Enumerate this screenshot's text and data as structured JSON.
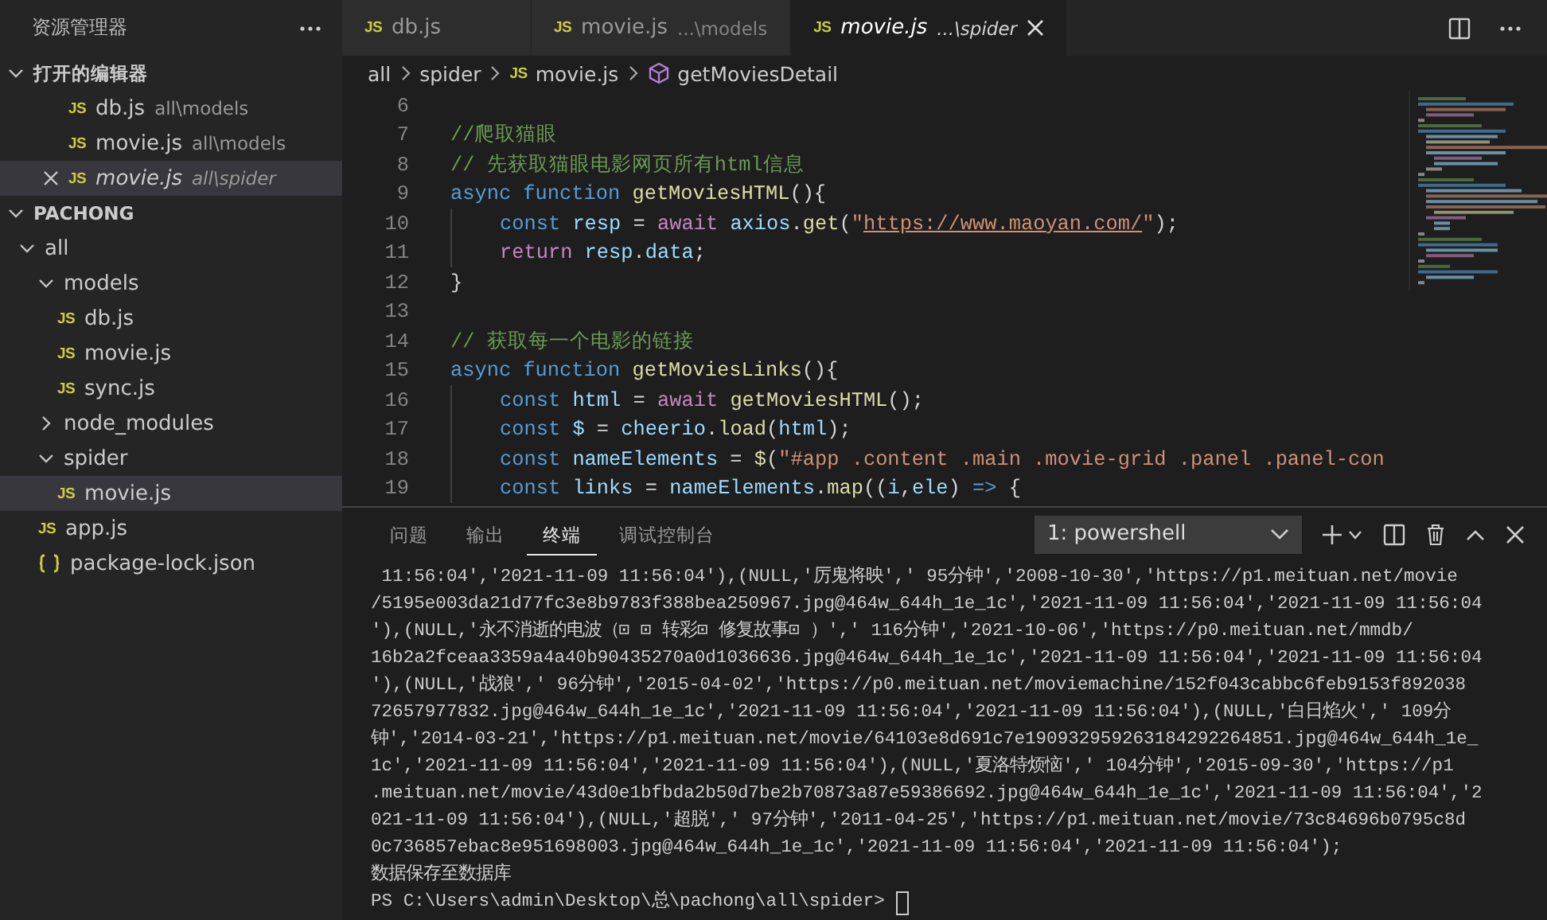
{
  "sidebar": {
    "title": "资源管理器",
    "open_editors": {
      "label": "打开的编辑器",
      "expanded": true,
      "items": [
        {
          "icon": "JS",
          "name": "db.js",
          "path": "all\\models",
          "selected": false,
          "preview": false
        },
        {
          "icon": "JS",
          "name": "movie.js",
          "path": "all\\models",
          "selected": false,
          "preview": false
        },
        {
          "icon": "JS",
          "name": "movie.js",
          "path": "all\\spider",
          "selected": true,
          "preview": true
        }
      ]
    },
    "project": {
      "label": "PACHONG",
      "expanded": true,
      "items": [
        {
          "label": "all",
          "kind": "folder",
          "expanded": true,
          "selected": false,
          "children": [
            {
              "label": "models",
              "kind": "folder",
              "expanded": true,
              "selected": false,
              "children": [
                {
                  "label": "db.js",
                  "kind": "js",
                  "icon": "JS",
                  "selected": false
                },
                {
                  "label": "movie.js",
                  "kind": "js",
                  "icon": "JS",
                  "selected": false
                },
                {
                  "label": "sync.js",
                  "kind": "js",
                  "icon": "JS",
                  "selected": false
                }
              ]
            },
            {
              "label": "node_modules",
              "kind": "folder",
              "expanded": false,
              "selected": false
            },
            {
              "label": "spider",
              "kind": "folder",
              "expanded": true,
              "selected": false,
              "children": [
                {
                  "label": "movie.js",
                  "kind": "js",
                  "icon": "JS",
                  "selected": true
                }
              ]
            },
            {
              "label": "app.js",
              "kind": "js",
              "icon": "JS",
              "selected": false
            },
            {
              "label": "package-lock.json",
              "kind": "json",
              "selected": false
            }
          ]
        }
      ]
    }
  },
  "editor": {
    "tabs": [
      {
        "icon": "JS",
        "name": "db.js",
        "selected": false,
        "preview": false
      },
      {
        "icon": "JS",
        "name": "movie.js",
        "path": "...\\models",
        "selected": false,
        "preview": false
      },
      {
        "icon": "JS",
        "name": "movie.js",
        "path": "...\\spider",
        "selected": true,
        "preview": true
      }
    ],
    "breadcrumb": [
      {
        "label": "all",
        "kind": "folder"
      },
      {
        "label": "spider",
        "kind": "folder"
      },
      {
        "label": "movie.js",
        "kind": "js",
        "icon": "JS"
      },
      {
        "label": "getMoviesDetail",
        "kind": "symbol"
      }
    ],
    "lines": [
      {
        "number": "6"
      },
      {
        "number": "7",
        "indented": false,
        "tokens": [
          {
            "kind": "comment",
            "text": "//爬取猫眼"
          }
        ]
      },
      {
        "number": "8",
        "indented": false,
        "tokens": [
          {
            "kind": "comment",
            "text": "// 先获取猫眼电影网页所有html信息"
          }
        ]
      },
      {
        "number": "9",
        "indented": false,
        "tokens": [
          {
            "kind": "keyword",
            "text": "async function "
          },
          {
            "kind": "function",
            "text": "getMoviesHTML"
          },
          {
            "kind": "plain",
            "text": "(){"
          }
        ]
      },
      {
        "number": "10",
        "indented": true,
        "tokens": [
          {
            "kind": "keyword",
            "text": "const "
          },
          {
            "kind": "variable",
            "text": "resp"
          },
          {
            "kind": "plain",
            "text": " = "
          },
          {
            "kind": "control",
            "text": "await "
          },
          {
            "kind": "variable",
            "text": "axios"
          },
          {
            "kind": "plain",
            "text": "."
          },
          {
            "kind": "function",
            "text": "get"
          },
          {
            "kind": "plain",
            "text": "("
          },
          {
            "kind": "string",
            "text": "\""
          },
          {
            "kind": "link",
            "text": "https://www.maoyan.com/"
          },
          {
            "kind": "string",
            "text": "\""
          },
          {
            "kind": "plain",
            "text": ");"
          }
        ]
      },
      {
        "number": "11",
        "indented": true,
        "tokens": [
          {
            "kind": "control",
            "text": "return "
          },
          {
            "kind": "variable",
            "text": "resp"
          },
          {
            "kind": "plain",
            "text": "."
          },
          {
            "kind": "variable",
            "text": "data"
          },
          {
            "kind": "plain",
            "text": ";"
          }
        ]
      },
      {
        "number": "12",
        "indented": false,
        "tokens": [
          {
            "kind": "plain",
            "text": "}"
          }
        ]
      },
      {
        "number": "13"
      },
      {
        "number": "14",
        "indented": false,
        "tokens": [
          {
            "kind": "comment",
            "text": "// 获取每一个电影的链接"
          }
        ]
      },
      {
        "number": "15",
        "indented": false,
        "tokens": [
          {
            "kind": "keyword",
            "text": "async function "
          },
          {
            "kind": "function",
            "text": "getMoviesLinks"
          },
          {
            "kind": "plain",
            "text": "(){"
          }
        ]
      },
      {
        "number": "16",
        "indented": true,
        "tokens": [
          {
            "kind": "keyword",
            "text": "const "
          },
          {
            "kind": "variable",
            "text": "html"
          },
          {
            "kind": "plain",
            "text": " = "
          },
          {
            "kind": "control",
            "text": "await "
          },
          {
            "kind": "function",
            "text": "getMoviesHTML"
          },
          {
            "kind": "plain",
            "text": "();"
          }
        ]
      },
      {
        "number": "17",
        "indented": true,
        "tokens": [
          {
            "kind": "keyword",
            "text": "const "
          },
          {
            "kind": "variable",
            "text": "$"
          },
          {
            "kind": "plain",
            "text": " = "
          },
          {
            "kind": "variable",
            "text": "cheerio"
          },
          {
            "kind": "plain",
            "text": "."
          },
          {
            "kind": "function",
            "text": "load"
          },
          {
            "kind": "plain",
            "text": "("
          },
          {
            "kind": "variable",
            "text": "html"
          },
          {
            "kind": "plain",
            "text": ");"
          }
        ]
      },
      {
        "number": "18",
        "indented": true,
        "tokens": [
          {
            "kind": "keyword",
            "text": "const "
          },
          {
            "kind": "variable",
            "text": "nameElements"
          },
          {
            "kind": "plain",
            "text": " = "
          },
          {
            "kind": "function",
            "text": "$"
          },
          {
            "kind": "plain",
            "text": "("
          },
          {
            "kind": "string",
            "text": "\"#app .content .main .movie-grid .panel .panel-con"
          }
        ]
      },
      {
        "number": "19",
        "indented": true,
        "tokens": [
          {
            "kind": "keyword",
            "text": "const "
          },
          {
            "kind": "variable",
            "text": "links"
          },
          {
            "kind": "plain",
            "text": " = "
          },
          {
            "kind": "variable",
            "text": "nameElements"
          },
          {
            "kind": "plain",
            "text": "."
          },
          {
            "kind": "function",
            "text": "map"
          },
          {
            "kind": "plain",
            "text": "(("
          },
          {
            "kind": "variable",
            "text": "i"
          },
          {
            "kind": "plain",
            "text": ","
          },
          {
            "kind": "variable",
            "text": "ele"
          },
          {
            "kind": "plain",
            "text": ") "
          },
          {
            "kind": "keyword",
            "text": "=>"
          },
          {
            "kind": "plain",
            "text": " {"
          }
        ]
      }
    ]
  },
  "panel": {
    "tabs": [
      {
        "label": "问题",
        "selected": false
      },
      {
        "label": "输出",
        "selected": false
      },
      {
        "label": "终端",
        "selected": true
      },
      {
        "label": "调试控制台",
        "selected": false
      }
    ],
    "terminal_picker": "1: powershell",
    "lines": [
      " 11:56:04','2021-11-09 11:56:04'),(NULL,'厉鬼将映',' 95分钟','2008-10-30','https://p1.meituan.net/movie",
      "/5195e003da21d77fc3e8b9783f388bea250967.jpg@464w_644h_1e_1c','2021-11-09 11:56:04','2021-11-09 11:56:04",
      "'),(NULL,'永不消逝的电波（⊡ ⊡ 转彩⊡ 修复故事⊡ ）',' 116分钟','2021-10-06','https://p0.meituan.net/mmdb/",
      "16b2a2fceaa3359a4a40b90435270a0d1036636.jpg@464w_644h_1e_1c','2021-11-09 11:56:04','2021-11-09 11:56:04",
      "'),(NULL,'战狼',' 96分钟','2015-04-02','https://p0.meituan.net/moviemachine/152f043cabbc6feb9153f892038",
      "72657977832.jpg@464w_644h_1e_1c','2021-11-09 11:56:04','2021-11-09 11:56:04'),(NULL,'白日焰火',' 109分",
      "钟','2014-03-21','https://p1.meituan.net/movie/64103e8d691c7e190932959263184292264851.jpg@464w_644h_1e_",
      "1c','2021-11-09 11:56:04','2021-11-09 11:56:04'),(NULL,'夏洛特烦恼',' 104分钟','2015-09-30','https://p1",
      ".meituan.net/movie/43d0e1bfbda2b50d7be2b70873a87e59386692.jpg@464w_644h_1e_1c','2021-11-09 11:56:04','2",
      "021-11-09 11:56:04'),(NULL,'超脱',' 97分钟','2011-04-25','https://p1.meituan.net/movie/73c84696b0795c8d",
      "0c736857ebac8e951698003.jpg@464w_644h_1e_1c','2021-11-09 11:56:04','2021-11-09 11:56:04');",
      "数据保存至数据库"
    ],
    "prompt": "PS C:\\Users\\admin\\Desktop\\总\\pachong\\all\\spider> "
  }
}
